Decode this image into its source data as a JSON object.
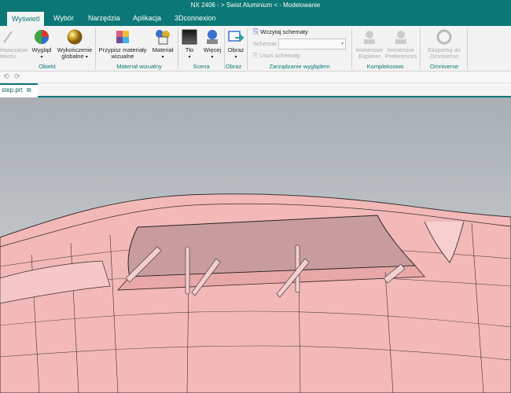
{
  "window": {
    "title": "NX 2406 - > Swist Aluminium < - Modelowanie"
  },
  "menu": {
    "tabs": [
      "Wyświetl",
      "Wybór",
      "Narzędzia",
      "Aplikacja",
      "3Dconnexion"
    ],
    "active": 0
  },
  "ribbon": {
    "obiekt": {
      "title": "Obiekt",
      "b0": "Przetwarzanie",
      "b0b": "tekstu",
      "b1": "Wygląd",
      "b2": "Wykończenie",
      "b2b": "globalne"
    },
    "material": {
      "title": "Materiał wizualny",
      "b0": "Przypisz materiały",
      "b0b": "wizualne",
      "b1": "Materiał"
    },
    "scena": {
      "title": "Scena",
      "b0": "Tło",
      "b1": "Więcej"
    },
    "obraz": {
      "title": "Obraz",
      "b0": "Obraz"
    },
    "schemat": {
      "title": "Zarządzanie wyglądem",
      "load": "Wczytaj schematy",
      "label": "Schemat",
      "delete": "Usuń schematy"
    },
    "kompleksowo": {
      "title": "Kompleksowo",
      "b0": "Immersive",
      "b0b": "Explorer",
      "b1": "Immersive",
      "b1b": "Preferences"
    },
    "omniverse": {
      "title": "Omniverse",
      "b0": "Eksportuj do",
      "b0b": "Omniverse"
    }
  },
  "document": {
    "tab_label": "step.prt"
  },
  "colors": {
    "accent": "#0b7877",
    "model_fill": "#f2b9b8",
    "model_edge": "#3a3030",
    "background_top": "#a8aeb3"
  }
}
